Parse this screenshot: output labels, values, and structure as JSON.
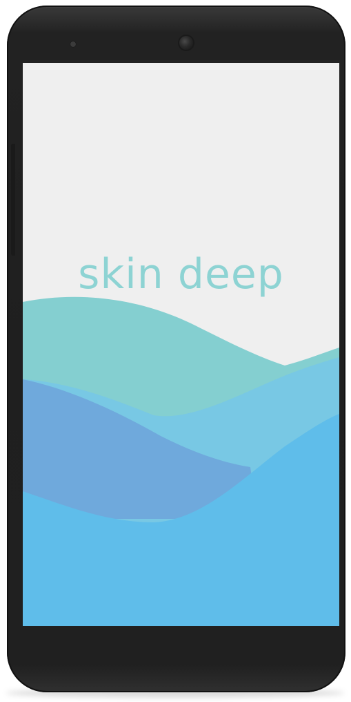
{
  "app": {
    "title": "skin deep"
  },
  "colors": {
    "screen_background": "#efefef",
    "title_text": "#8dd3d3",
    "wave_teal": "#84cfd0",
    "wave_sky": "#78c8e4",
    "wave_blue": "#6fa9dc",
    "wave_bright": "#5fbdea",
    "phone_body": "#202020"
  }
}
